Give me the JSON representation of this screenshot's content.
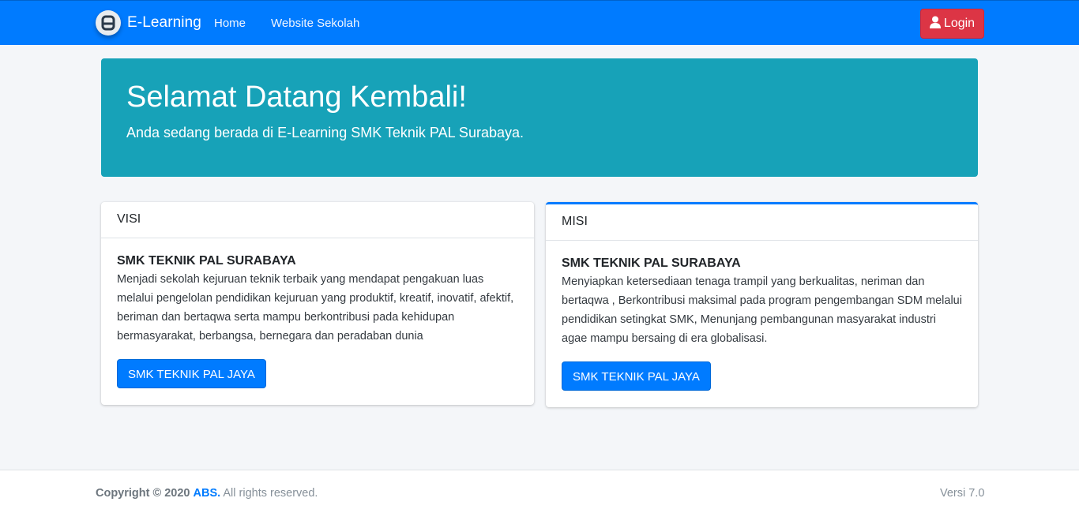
{
  "navbar": {
    "brand": "E-Learning",
    "links": [
      {
        "label": "Home"
      },
      {
        "label": "Website Sekolah"
      }
    ],
    "login_label": "Login",
    "brand_logo_icon": "abs-logo-icon",
    "login_icon": "user-icon"
  },
  "hero": {
    "title": "Selamat Datang Kembali!",
    "lead": "Anda sedang berada di E-Learning SMK Teknik PAL Surabaya."
  },
  "visi": {
    "header": "VISI",
    "title": "SMK TEKNIK PAL SURABAYA",
    "text": "Menjadi sekolah kejuruan teknik terbaik yang mendapat pengakuan luas melalui pengelolan pendidikan kejuruan yang produktif, kreatif, inovatif, afektif, beriman dan bertaqwa serta mampu berkontribusi pada kehidupan bermasyarakat, berbangsa, bernegara dan peradaban dunia",
    "button": "SMK TEKNIK PAL JAYA"
  },
  "misi": {
    "header": "MISI",
    "title": "SMK TEKNIK PAL SURABAYA",
    "text": "Menyiapkan ketersediaan tenaga trampil yang berkualitas, neriman dan bertaqwa , Berkontribusi maksimal pada program pengembangan SDM melalui pendidikan setingkat SMK, Menunjang pembangunan masyarakat industri agae mampu bersaing di era globalisasi.",
    "button": "SMK TEKNIK PAL JAYA"
  },
  "footer": {
    "copyright_prefix": "Copyright © 2020",
    "brand": "ABS.",
    "rights": "All rights reserved.",
    "version": "Versi 7.0"
  },
  "colors": {
    "primary": "#007bff",
    "info": "#17a2b8",
    "danger": "#dc3545",
    "background": "#f4f6f9"
  }
}
